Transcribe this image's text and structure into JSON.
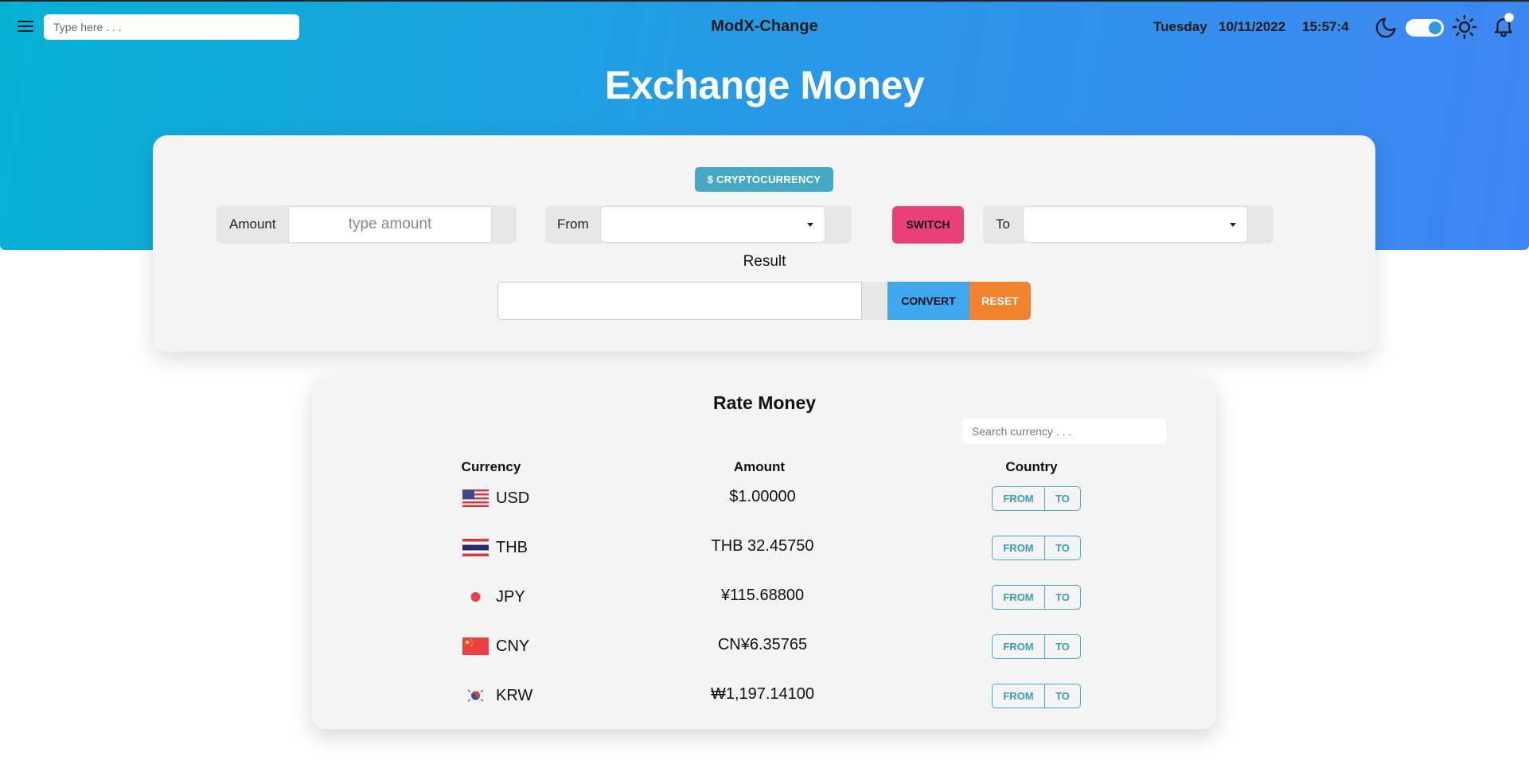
{
  "header": {
    "search_placeholder": "Type here . . .",
    "brand": "ModX-Change",
    "day": "Tuesday",
    "date": "10/11/2022",
    "time": "15:57:4",
    "theme_toggle_on": true,
    "icons": [
      "menu-icon",
      "moon-icon",
      "sun-icon",
      "bell-icon"
    ]
  },
  "page_title": "Exchange Money",
  "converter": {
    "badge": "$ CRYPTOCURRENCY",
    "amount_label": "Amount",
    "amount_placeholder": "type amount",
    "from_label": "From",
    "from_value": "",
    "switch_label": "SWITCH",
    "to_label": "To",
    "to_value": "",
    "result_label": "Result",
    "result_value": "",
    "convert_label": "CONVERT",
    "reset_label": "RESET"
  },
  "rates": {
    "title": "Rate Money",
    "search_placeholder": "Search currency . . .",
    "columns": [
      "Currency",
      "Amount",
      "Country"
    ],
    "from_label": "FROM",
    "to_label": "TO",
    "rows": [
      {
        "code": "USD",
        "amount": "$1.00000",
        "flag": "us-flag"
      },
      {
        "code": "THB",
        "amount": "THB 32.45750",
        "flag": "th-flag"
      },
      {
        "code": "JPY",
        "amount": "¥115.68800",
        "flag": "jp-flag"
      },
      {
        "code": "CNY",
        "amount": "CN¥6.35765",
        "flag": "cn-flag"
      },
      {
        "code": "KRW",
        "amount": "₩1,197.14100",
        "flag": "kr-flag"
      }
    ]
  },
  "colors": {
    "hero_start": "#06b2d4",
    "hero_end": "#3f86f4",
    "badge": "#45a9c5",
    "switch": "#e9407a",
    "convert": "#3fa7ee",
    "reset": "#f1832f"
  }
}
